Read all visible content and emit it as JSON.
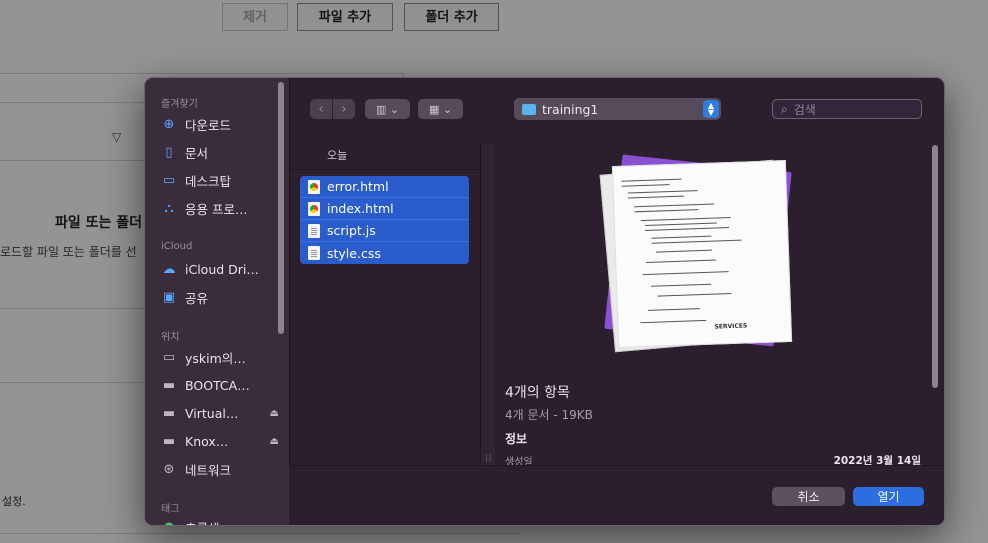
{
  "background": {
    "buttons": {
      "remove": "제거",
      "add_file": "파일 추가",
      "add_folder": "폴더 추가"
    },
    "drop_title": "파일 또는 폴더",
    "drop_hint": "로드할 파일 또는 폴더를 선",
    "settings_text": "설정."
  },
  "dialog": {
    "sidebar": {
      "favorites_header": "즐겨찾기",
      "favorites": [
        {
          "label": "다운로드",
          "icon": "download-icon"
        },
        {
          "label": "문서",
          "icon": "document-icon"
        },
        {
          "label": "데스크탑",
          "icon": "desktop-icon"
        },
        {
          "label": "응용 프로…",
          "icon": "applications-icon"
        }
      ],
      "icloud_header": "iCloud",
      "icloud": [
        {
          "label": "iCloud Dri…",
          "icon": "cloud-icon"
        },
        {
          "label": "공유",
          "icon": "shared-folder-icon"
        }
      ],
      "locations_header": "위치",
      "locations": [
        {
          "label": "yskim의…",
          "icon": "laptop-icon"
        },
        {
          "label": "BOOTCA…",
          "icon": "disk-icon"
        },
        {
          "label": "Virtual…",
          "icon": "disk-icon"
        },
        {
          "label": "Knox…",
          "icon": "disk-icon"
        },
        {
          "label": "네트워크",
          "icon": "network-icon"
        }
      ],
      "tags_header": "태그",
      "tags_first": "초록색"
    },
    "toolbar": {
      "location": "training1",
      "search_placeholder": "검색"
    },
    "column_header": "오늘",
    "files": [
      {
        "name": "error.html",
        "icon": "chrome-html-icon"
      },
      {
        "name": "index.html",
        "icon": "chrome-html-icon"
      },
      {
        "name": "script.js",
        "icon": "js-file-icon"
      },
      {
        "name": "style.css",
        "icon": "css-file-icon"
      }
    ],
    "preview": {
      "title": "4개의 항목",
      "subtitle": "4개 문서 - 19KB",
      "info_header": "정보",
      "created_label": "생성일",
      "created_value": "2022년 3월 14일",
      "thumb_text": "SERVICES"
    },
    "buttons": {
      "cancel": "취소",
      "open": "열기"
    }
  }
}
